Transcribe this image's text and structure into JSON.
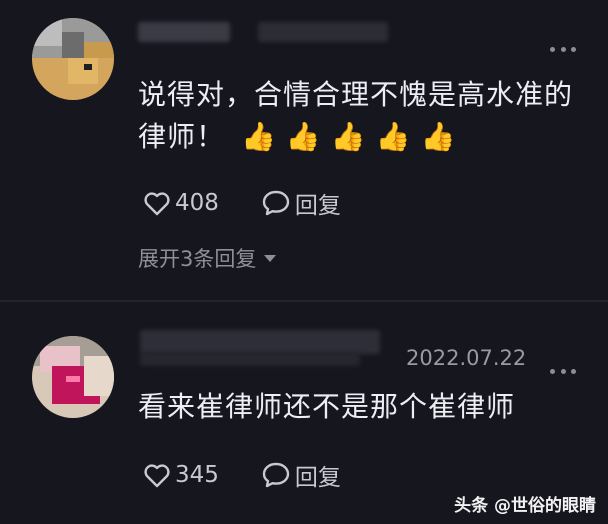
{
  "comments": [
    {
      "text_line1": "说得对，合情合理不愧是高水准的",
      "text_line2": "律师！",
      "reactions": [
        "👍",
        "👍",
        "👍",
        "👍",
        "👍"
      ],
      "likes": "408",
      "reply_label": "回复",
      "expand_label": "展开3条回复"
    },
    {
      "date": "2022.07.22",
      "text": "看来崔律师还不是那个崔律师",
      "likes": "345",
      "reply_label": "回复"
    }
  ],
  "watermark": "头条 @世俗的眼睛"
}
